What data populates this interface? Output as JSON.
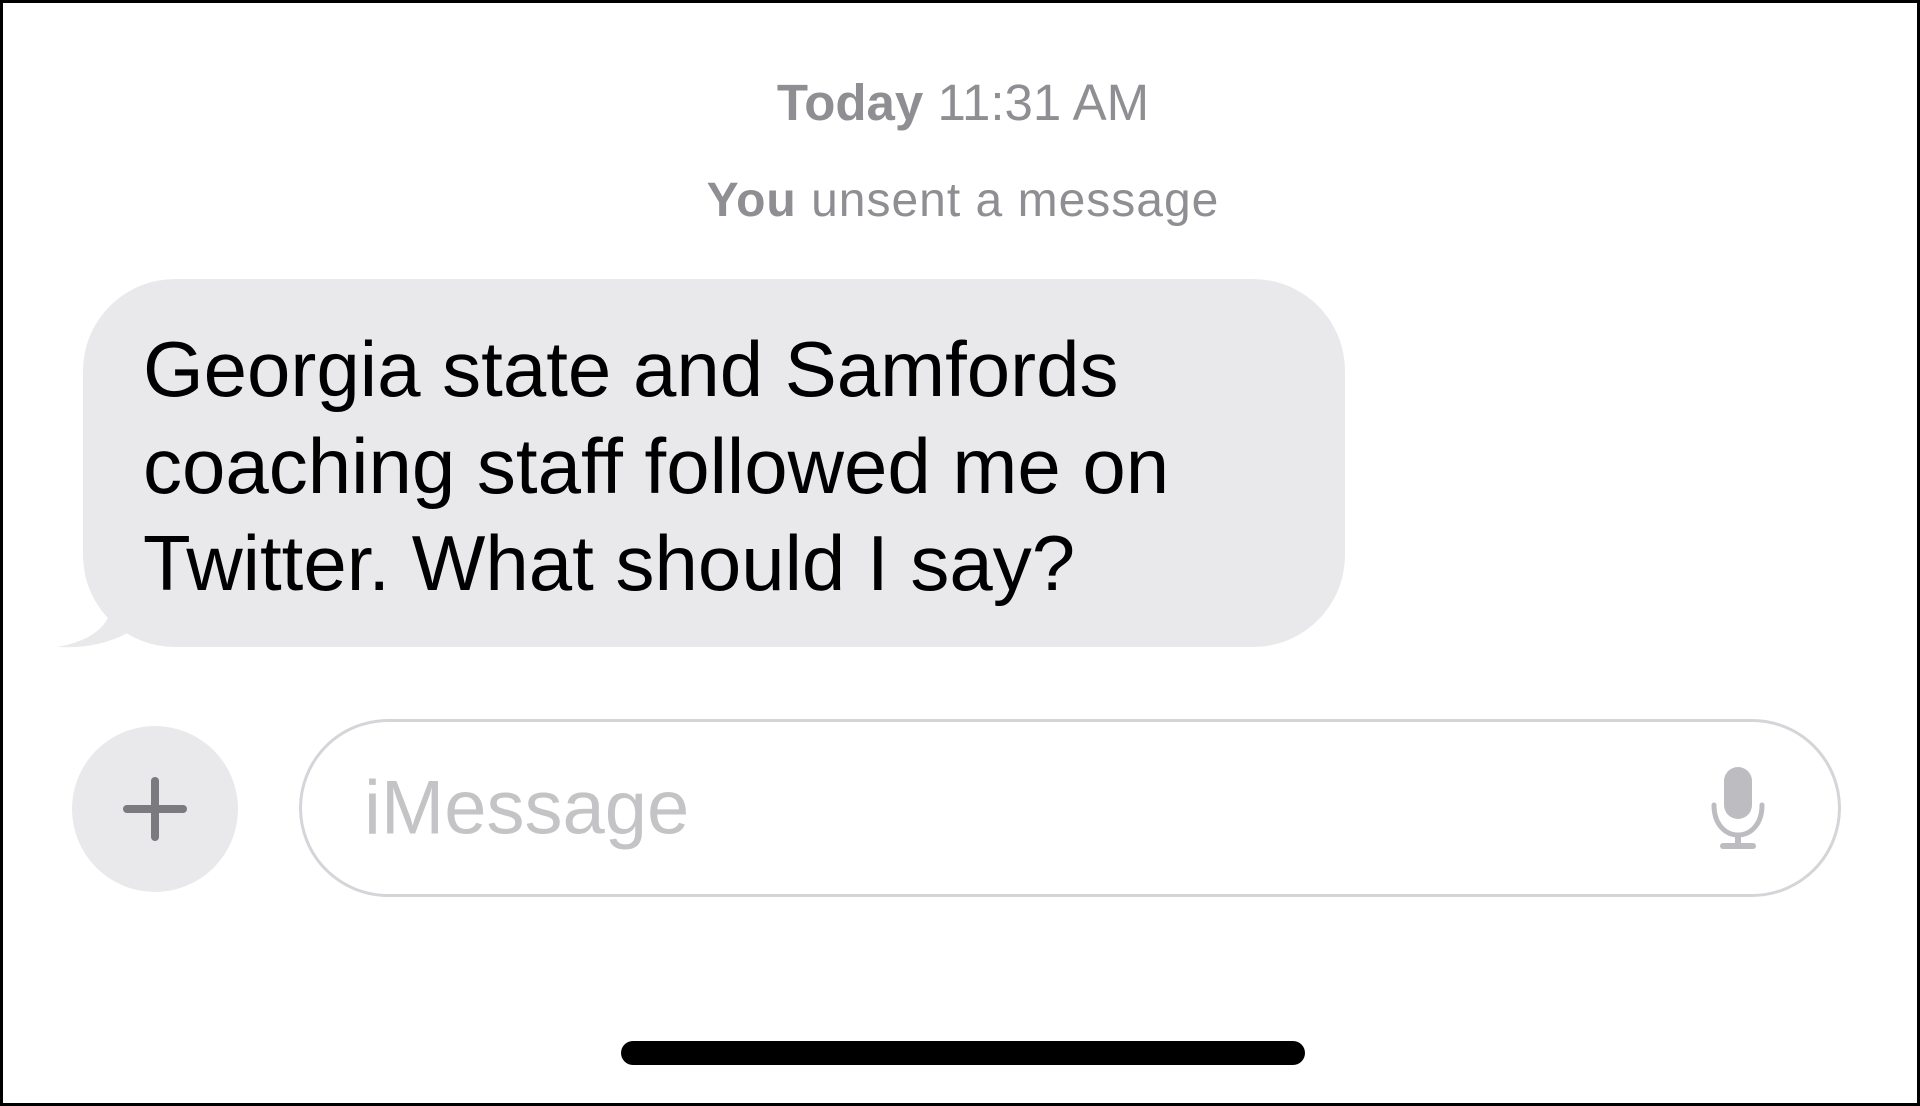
{
  "conversation": {
    "timestamp_day": "Today",
    "timestamp_time": "11:31 AM",
    "unsent_subject": "You",
    "unsent_text": "unsent a message"
  },
  "messages": [
    {
      "direction": "incoming",
      "text": "Georgia state and Samfords coaching staff followed me on Twitter. What should I say?"
    }
  ],
  "composer": {
    "placeholder": "iMessage",
    "plus_icon": "plus-icon",
    "mic_icon": "microphone-icon"
  },
  "colors": {
    "incoming_bubble": "#e9e9eb",
    "meta_text": "#8e8e93",
    "placeholder_text": "#c4c4c7"
  }
}
